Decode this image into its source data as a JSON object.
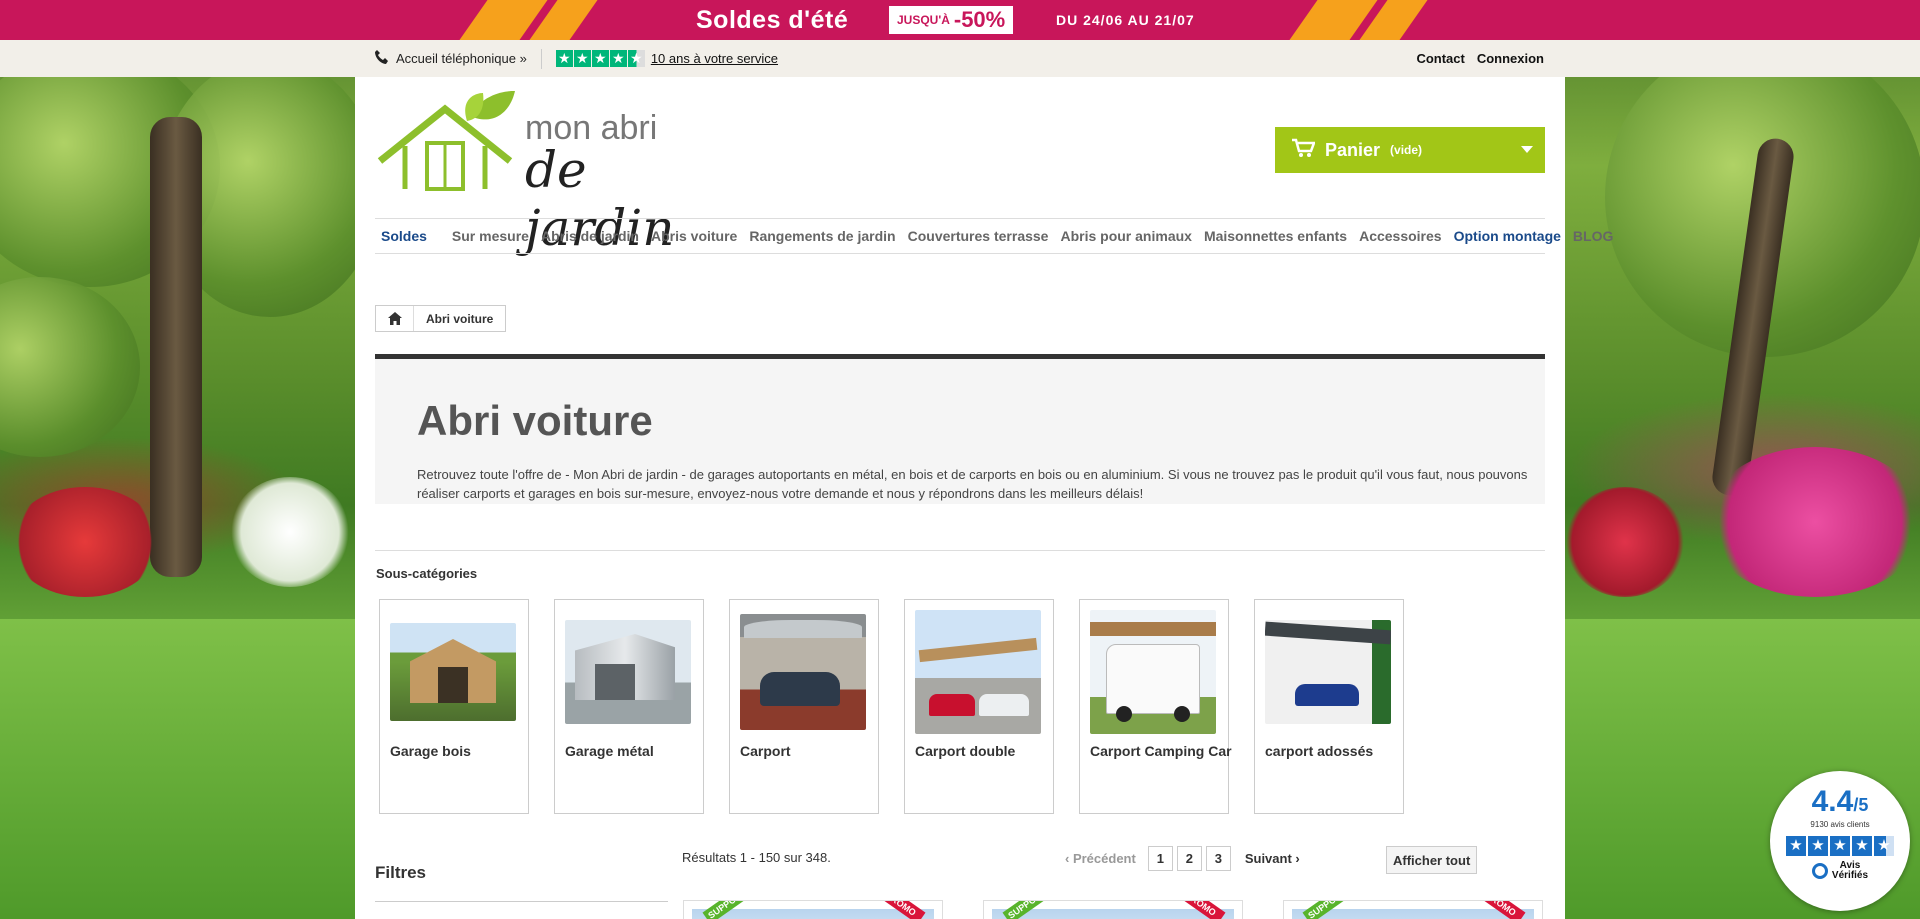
{
  "promo": {
    "title": "Soldes d'été",
    "prefix": "JUSQU'À",
    "discount": "-50%",
    "dates": "DU 24/06 AU 21/07"
  },
  "topbar": {
    "phone_label": "Accueil téléphonique »",
    "trust_text": "10 ans à votre service",
    "contact": "Contact",
    "login": "Connexion"
  },
  "header": {
    "logo_line1": "mon abri",
    "logo_line2": "de jardin",
    "cart_label": "Panier",
    "cart_status": "(vide)"
  },
  "nav": [
    "Soldes",
    "Sur mesure",
    "Abris de jardin",
    "Abris voiture",
    "Rangements de jardin",
    "Couvertures terrasse",
    "Abris pour animaux",
    "Maisonnettes enfants",
    "Accessoires",
    "Option montage",
    "BLOG"
  ],
  "breadcrumb": {
    "current": "Abri voiture"
  },
  "category": {
    "title": "Abri voiture",
    "description": "Retrouvez toute l'offre de - Mon Abri de jardin - de garages autoportants en métal, en bois et de carports en bois ou en aluminium. Si vous ne trouvez pas le produit qu'il vous faut, nous pouvons réaliser carports et garages en bois sur-mesure, envoyez-nous votre demande et nous y répondrons dans les meilleurs délais!"
  },
  "subcategories": {
    "title": "Sous-catégories",
    "items": [
      "Garage bois",
      "Garage métal",
      "Carport",
      "Carport double",
      "Carport Camping Car",
      "carport adossés"
    ]
  },
  "filters": {
    "title": "Filtres"
  },
  "listing": {
    "results": "Résultats 1 - 150 sur 348.",
    "prev": "Précédent",
    "pages": [
      "1",
      "2",
      "3"
    ],
    "next": "Suivant",
    "show_all": "Afficher tout"
  },
  "product_ribbons": {
    "left": "SUPPORT",
    "right": "PROMO"
  },
  "reviews": {
    "score": "4.4",
    "out_of": "/5",
    "count": "9130 avis clients",
    "brand_line1": "Avis",
    "brand_line2": "Vérifiés"
  },
  "colors": {
    "promo_bg": "#c8165a",
    "promo_accent": "#f6a11c",
    "cart_green": "#a2c617",
    "nav_blue": "#1a4a8a",
    "trust_green": "#00b67a",
    "reviews_blue": "#1a6fc4"
  }
}
